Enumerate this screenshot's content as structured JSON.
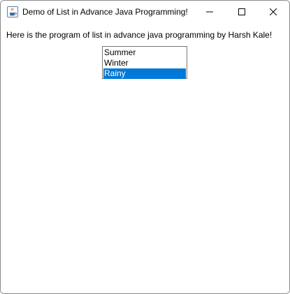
{
  "window": {
    "title": "Demo of List in Advance Java Programming!",
    "icon": "java-coffee-cup-icon",
    "controls": {
      "minimize_icon": "minimize-icon",
      "maximize_icon": "maximize-icon",
      "close_icon": "close-icon"
    }
  },
  "main": {
    "heading": "Here is the program of list in advance java programming by Harsh Kale!",
    "list": {
      "items": [
        "Summer",
        "Winter",
        "Rainy"
      ],
      "selected": "Rainy"
    }
  },
  "colors": {
    "selection": "#0078d7",
    "selection_text": "#ffffff"
  }
}
